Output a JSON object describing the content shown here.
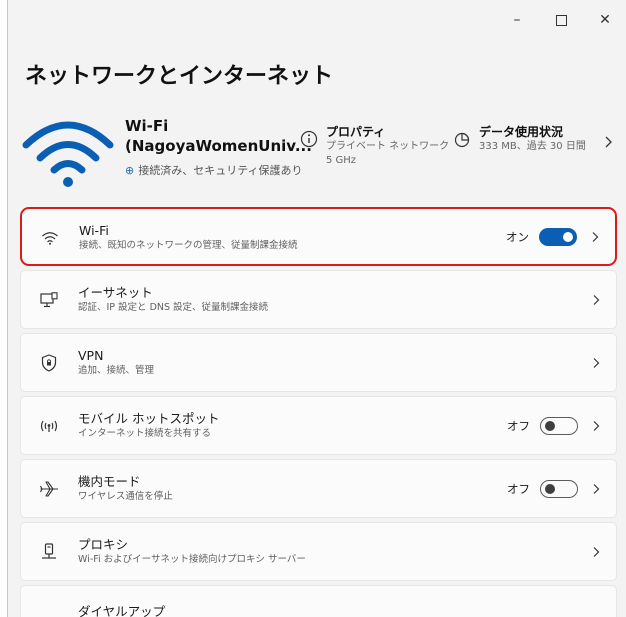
{
  "window": {
    "page_title": "ネットワークとインターネット",
    "caption_buttons": {
      "minimize": "–",
      "close": "✕"
    }
  },
  "hero": {
    "name_line1": "Wi-Fi",
    "name_line2": "(NagoyaWomenUniv...",
    "status": "接続済み、セキュリティ保護あり",
    "properties": {
      "title": "プロパティ",
      "line1": "プライベート ネットワーク",
      "line2": "5 GHz"
    },
    "data_usage": {
      "title": "データ使用状況",
      "sub": "333 MB、過去 30 日間"
    }
  },
  "settings": [
    {
      "icon": "wifi-icon",
      "title": "Wi-Fi",
      "sub": "接続、既知のネットワークの管理、従量制課金接続",
      "state": "オン",
      "toggle": "on",
      "highlighted": true
    },
    {
      "icon": "ethernet-icon",
      "title": "イーサネット",
      "sub": "認証、IP 設定と DNS 設定、従量制課金接続"
    },
    {
      "icon": "vpn-shield-icon",
      "title": "VPN",
      "sub": "追加、接続、管理"
    },
    {
      "icon": "mobile-hotspot-icon",
      "title": "モバイル ホットスポット",
      "sub": "インターネット接続を共有する",
      "state": "オフ",
      "toggle": "off"
    },
    {
      "icon": "airplane-icon",
      "title": "機内モード",
      "sub": "ワイヤレス通信を停止",
      "state": "オフ",
      "toggle": "off"
    },
    {
      "icon": "proxy-icon",
      "title": "プロキシ",
      "sub": "Wi-Fi およびイーサネット接続向けプロキシ サーバー"
    },
    {
      "icon": "dialup-icon",
      "title": "ダイヤルアップ"
    }
  ],
  "colors": {
    "accent": "#0a5fb4",
    "highlight": "#d81b1b",
    "background": "#f3f3f3",
    "card": "#fbfbfb"
  }
}
